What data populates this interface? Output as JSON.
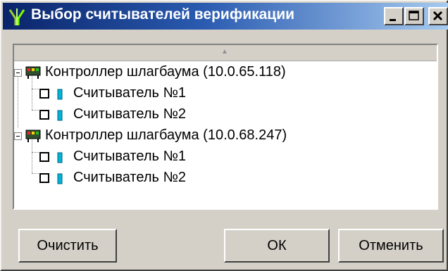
{
  "window": {
    "title": "Выбор считывателей верификации"
  },
  "titlebar_buttons": {
    "minimize": "minimize-icon",
    "maximize": "maximize-icon",
    "close": "close-icon"
  },
  "scroll_up_glyph": "▲",
  "tree": [
    {
      "label": "Контроллер шлагбаума (10.0.65.118)",
      "expanded": true,
      "icon": "controller-icon",
      "children": [
        {
          "label": "Считыватель №1",
          "checked": false,
          "icon": "reader-icon"
        },
        {
          "label": "Считыватель №2",
          "checked": false,
          "icon": "reader-icon"
        }
      ]
    },
    {
      "label": "Контроллер шлагбаума (10.0.68.247)",
      "expanded": true,
      "icon": "controller-icon",
      "children": [
        {
          "label": "Считыватель №1",
          "checked": false,
          "icon": "reader-icon"
        },
        {
          "label": "Считыватель №2",
          "checked": false,
          "icon": "reader-icon"
        }
      ]
    }
  ],
  "buttons": {
    "clear": "Очистить",
    "ok": "ОК",
    "cancel": "Отменить"
  },
  "colors": {
    "title_start": "#0a246a",
    "title_end": "#a6caf0",
    "face": "#d4d0c8",
    "reader": "#00b4d8"
  }
}
